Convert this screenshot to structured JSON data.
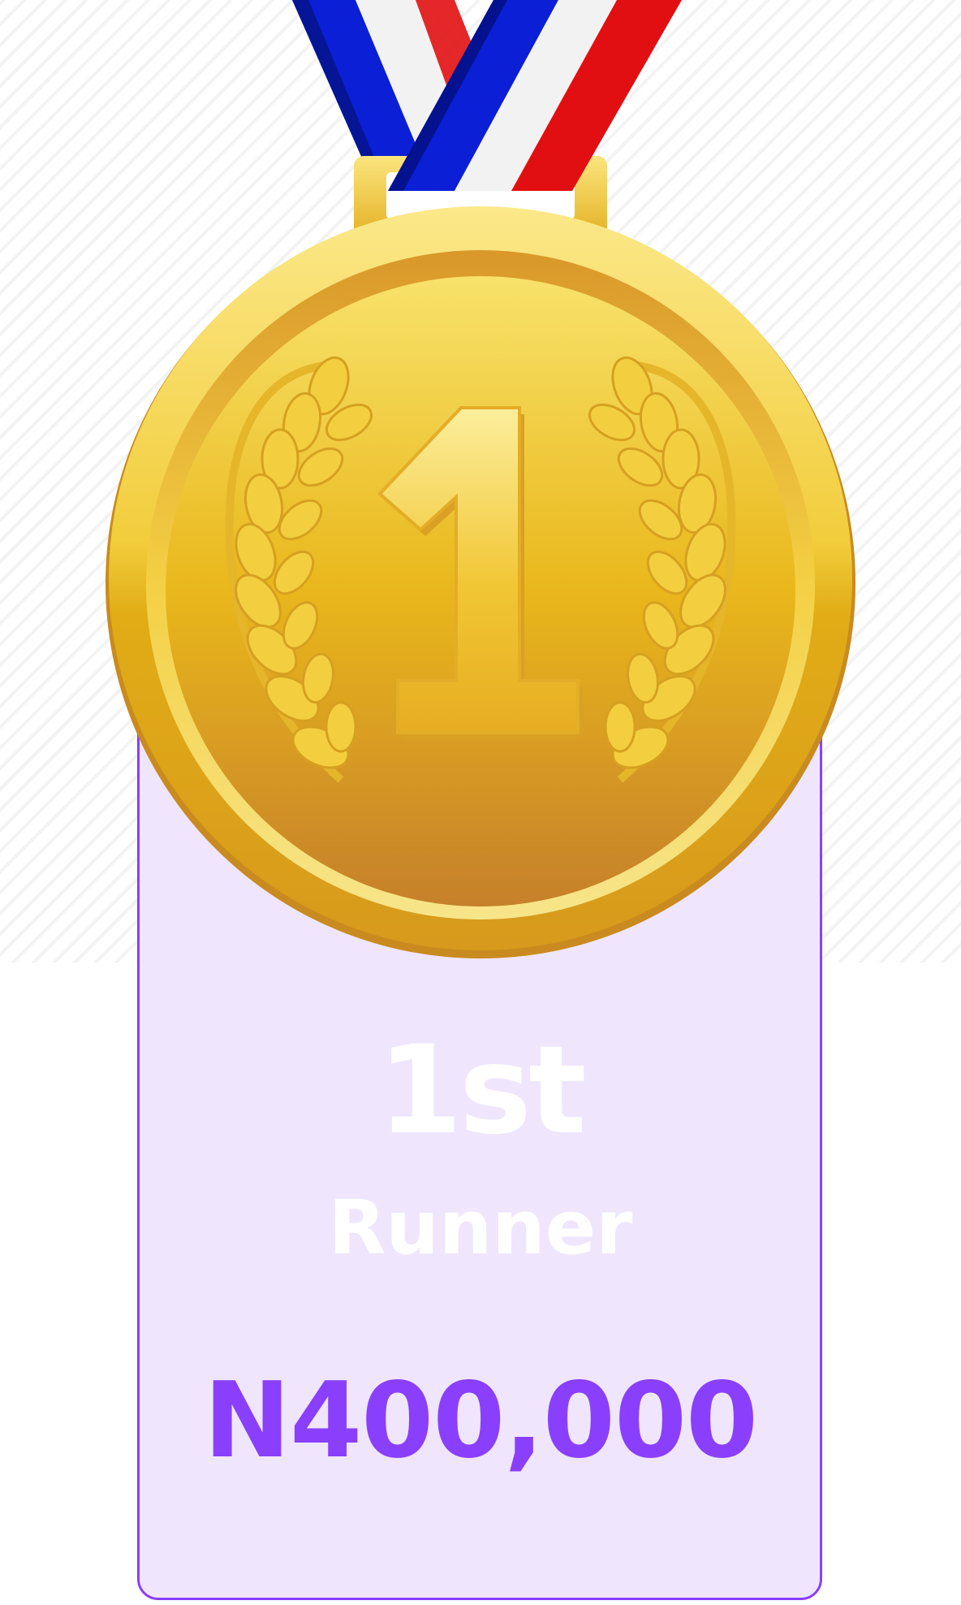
{
  "prize": {
    "place": "1st",
    "role": "Runner",
    "amount": "N400,000"
  },
  "medal": {
    "icon": "gold-medal-icon",
    "number": "1",
    "ribbon_colors": [
      "#0a1fd6",
      "#f2f2f2",
      "#e10f12"
    ],
    "gold_colors": [
      "#f7e27a",
      "#e8b923",
      "#c98a2a"
    ]
  },
  "colors": {
    "accent": "#8a3ffc",
    "card_background": "#efe6fd"
  }
}
